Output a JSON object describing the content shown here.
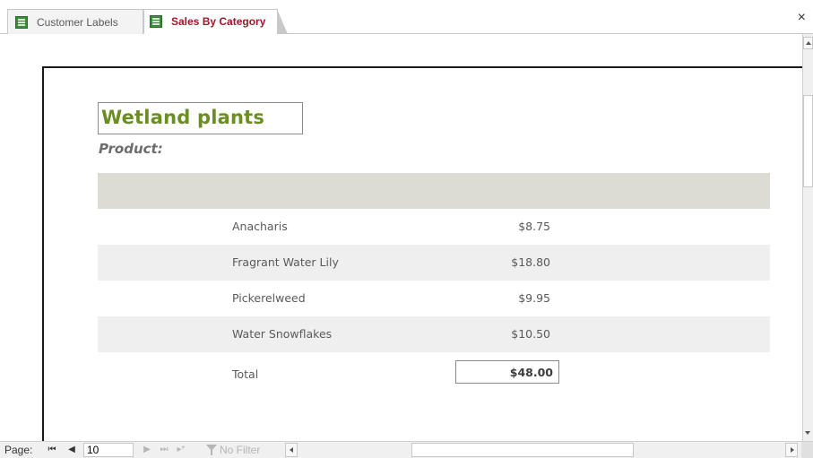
{
  "tabs": [
    {
      "label": "Customer Labels",
      "icon": "report-icon",
      "active": false
    },
    {
      "label": "Sales By Category",
      "icon": "report-icon",
      "active": true
    }
  ],
  "window": {
    "close_glyph": "×"
  },
  "report": {
    "category_title": "Wetland plants",
    "product_label": "Product:",
    "rows": [
      {
        "name": "Anacharis",
        "price": "$8.75"
      },
      {
        "name": "Fragrant Water Lily",
        "price": "$18.80"
      },
      {
        "name": "Pickerelweed",
        "price": "$9.95"
      },
      {
        "name": "Water Snowflakes",
        "price": "$10.50"
      }
    ],
    "total_label": "Total",
    "total_value": "$48.00"
  },
  "navigation": {
    "page_label": "Page:",
    "current_page": "10",
    "first_glyph": "⏮",
    "prev_glyph": "◀",
    "next_glyph": "▶",
    "last_glyph": "⏭",
    "filter_label": "No Filter"
  },
  "colors": {
    "category_title": "#6b8e23",
    "active_tab_text": "#a0162b",
    "header_band": "#dcdcd4",
    "alt_row": "#efefef"
  }
}
